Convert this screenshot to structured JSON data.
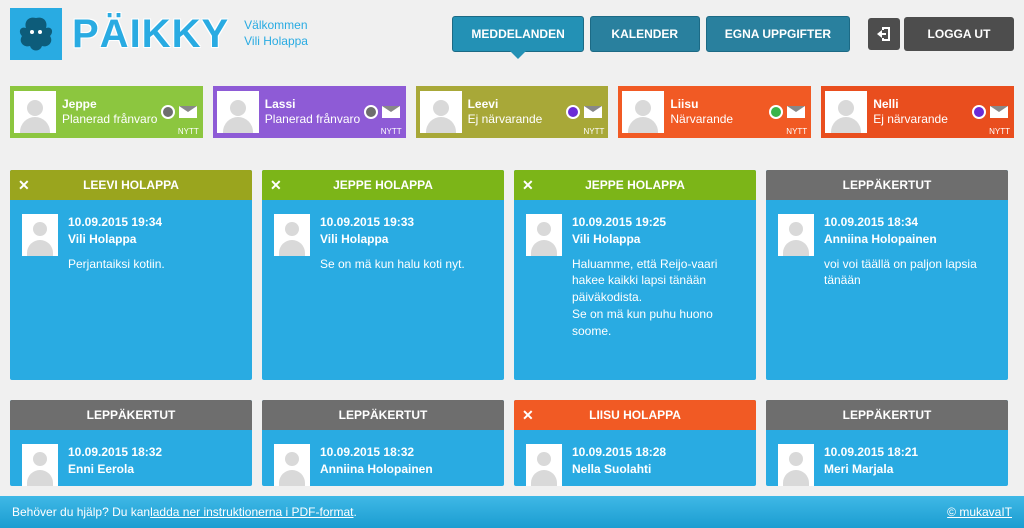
{
  "header": {
    "brand": "PÄIKKY",
    "welcome_line1": "Välkommen",
    "welcome_line2": "Vili Holappa",
    "nav": {
      "meddelanden": "MEDDELANDEN",
      "kalender": "KALENDER",
      "egna": "EGNA UPPGIFTER",
      "logout": "LOGGA UT"
    }
  },
  "children": [
    {
      "name": "Jeppe",
      "status": "Planerad frånvaro",
      "nytt": "NYTT"
    },
    {
      "name": "Lassi",
      "status": "Planerad frånvaro",
      "nytt": "NYTT"
    },
    {
      "name": "Leevi",
      "status": "Ej närvarande",
      "nytt": "NYTT"
    },
    {
      "name": "Liisu",
      "status": "Närvarande",
      "nytt": "NYTT"
    },
    {
      "name": "Nelli",
      "status": "Ej närvarande",
      "nytt": "NYTT"
    }
  ],
  "cards1": [
    {
      "title": "LEEVI HOLAPPA",
      "closable": true,
      "ts": "10.09.2015 19:34",
      "author": "Vili Holappa",
      "text": "Perjantaiksi kotiin."
    },
    {
      "title": "JEPPE HOLAPPA",
      "closable": true,
      "ts": "10.09.2015 19:33",
      "author": "Vili Holappa",
      "text": "Se on mä kun halu koti nyt."
    },
    {
      "title": "JEPPE HOLAPPA",
      "closable": true,
      "ts": "10.09.2015 19:25",
      "author": "Vili Holappa",
      "text": "Haluamme, että Reijo-vaari hakee kaikki lapsi tänään päiväkodista.\nSe on mä kun puhu huono soome."
    },
    {
      "title": "LEPPÄKERTUT",
      "closable": false,
      "ts": "10.09.2015 18:34",
      "author": "Anniina Holopainen",
      "text": "voi voi täällä on paljon lapsia tänään"
    }
  ],
  "cards2": [
    {
      "title": "LEPPÄKERTUT",
      "closable": false,
      "ts": "10.09.2015 18:32",
      "author": "Enni Eerola"
    },
    {
      "title": "LEPPÄKERTUT",
      "closable": false,
      "ts": "10.09.2015 18:32",
      "author": "Anniina Holopainen"
    },
    {
      "title": "LIISU HOLAPPA",
      "closable": true,
      "ts": "10.09.2015 18:28",
      "author": "Nella Suolahti"
    },
    {
      "title": "LEPPÄKERTUT",
      "closable": false,
      "ts": "10.09.2015 18:21",
      "author": "Meri Marjala"
    }
  ],
  "footer": {
    "pre": "Behöver du hjälp? Du kan ",
    "link": "ladda ner instruktionerna i PDF-format",
    "post": ".",
    "copy": "© mukavaIT"
  }
}
